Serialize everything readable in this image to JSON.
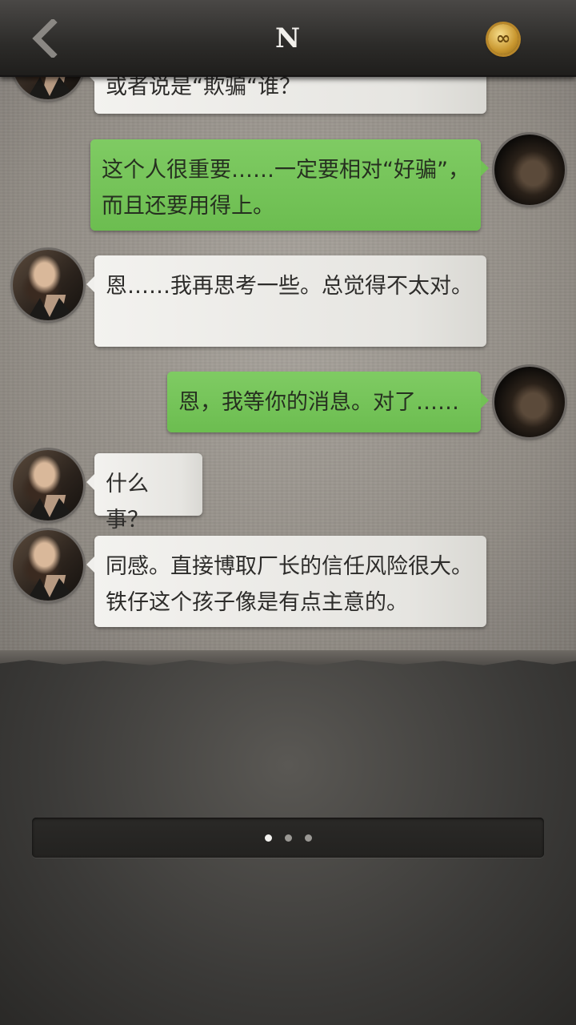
{
  "header": {
    "title": "N",
    "back_icon": "chevron-left-icon",
    "badge_icon": "infinity-icon",
    "badge_symbol": "∞"
  },
  "messages": [
    {
      "side": "in",
      "text": "或者说是“欺骗“谁？",
      "avatar": "npc-avatar"
    },
    {
      "side": "out",
      "text": "这个人很重要……一定要相对“好骗”，而且还要用得上。",
      "avatar": "player-avatar"
    },
    {
      "side": "in",
      "text": "恩……我再思考一些。总觉得不太对。",
      "avatar": "npc-avatar"
    },
    {
      "side": "out",
      "text": "恩，我等你的消息。对了……",
      "avatar": "player-avatar"
    },
    {
      "side": "in",
      "text": "什么事？",
      "avatar": "npc-avatar"
    },
    {
      "side": "in",
      "text": "同感。直接博取厂长的信任风险很大。铁仔这个孩子像是有点主意的。",
      "avatar": "npc-avatar"
    }
  ],
  "pager": {
    "total": 3,
    "active_index": 0
  },
  "colors": {
    "outgoing_bubble": "#6cbd50",
    "incoming_bubble": "#ecebe7",
    "topbar": "#2c2b29"
  }
}
